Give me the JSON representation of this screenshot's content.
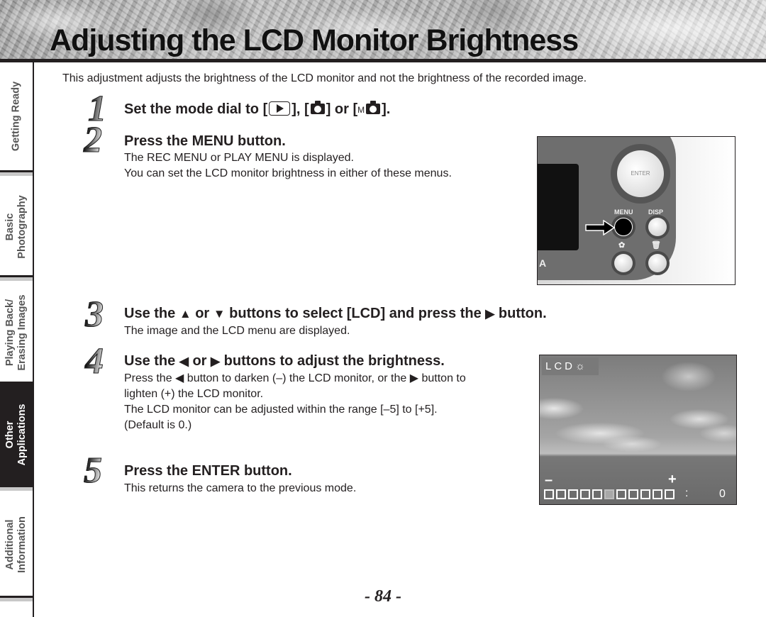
{
  "header": {
    "title": "Adjusting the LCD Monitor Brightness"
  },
  "sidebar": {
    "tabs": [
      {
        "label": "Getting Ready",
        "active": false
      },
      {
        "label": "Basic\nPhotography",
        "active": false
      },
      {
        "label": "Playing Back/\nErasing Images",
        "active": false
      },
      {
        "label": "Other\nApplications",
        "active": true
      },
      {
        "label": "Additional\nInformation",
        "active": false
      }
    ]
  },
  "intro": "This adjustment adjusts the brightness of the LCD monitor and not the brightness of the recorded image.",
  "steps": [
    {
      "number": "1",
      "title_prefix": "Set the mode dial to  [",
      "title_sep1": "],  [",
      "title_sep2": "] or [",
      "title_m": "M",
      "title_suffix": "].",
      "icons": [
        "play-mode-icon",
        "camera-mode-icon",
        "manual-camera-mode-icon"
      ]
    },
    {
      "number": "2",
      "title": "Press the MENU button.",
      "lines": [
        "The REC MENU or PLAY MENU is displayed.",
        "You can set the LCD monitor brightness in either of these menus."
      ]
    },
    {
      "number": "3",
      "title_a": "Use the ",
      "up": "▲",
      "title_b": " or ",
      "down": "▼",
      "title_c": " buttons to select [LCD] and press the ",
      "right": "▶",
      "title_d": " button.",
      "lines": [
        "The image and the LCD menu are displayed."
      ]
    },
    {
      "number": "4",
      "title_a": "Use the ",
      "left": "◀",
      "title_b": " or ",
      "right": "▶",
      "title_c": " buttons to adjust the brightness.",
      "line1_a": "Press the ",
      "line1_b": " button to darken (–) the LCD monitor, or the ",
      "line1_c": " button to",
      "line2": "lighten (+) the LCD monitor.",
      "line3": "The LCD monitor can be adjusted within the range [–5] to [+5].",
      "line4": "(Default is 0.)"
    },
    {
      "number": "5",
      "title": "Press the ENTER button.",
      "lines": [
        "This returns the camera to the previous mode."
      ]
    }
  ],
  "camera_photo": {
    "dial_label": "ENTER",
    "menu_label": "MENU",
    "disp_label": "DISP",
    "brand_fragment": "A"
  },
  "lcd_screen": {
    "badge": "LCD",
    "sun_icon": "☼",
    "minus": "–",
    "plus": "+",
    "colon": ":",
    "value": "0",
    "range_min": -5,
    "range_max": 5,
    "current": 0
  },
  "page_number": "- 84 -"
}
